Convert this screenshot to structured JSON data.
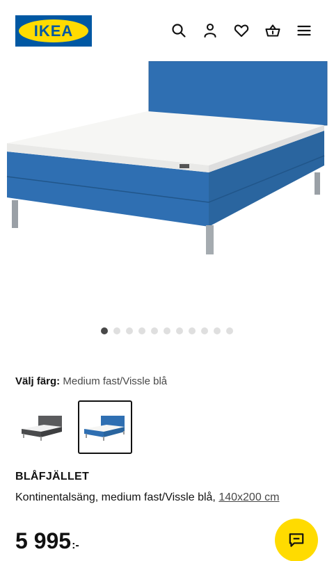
{
  "header": {
    "logo_text": "IKEA",
    "icons": [
      "search-icon",
      "user-icon",
      "heart-icon",
      "basket-icon",
      "menu-icon"
    ]
  },
  "product_image": {
    "color": "#2f6fb2",
    "carousel": {
      "total": 11,
      "active_index": 0
    }
  },
  "color_selector": {
    "label": "Välj färg:",
    "value": "Medium fast/Vissle blå",
    "options": [
      {
        "name": "grey",
        "color": "#5a5b5d",
        "selected": false
      },
      {
        "name": "blue",
        "color": "#2f6fb2",
        "selected": true
      }
    ]
  },
  "product": {
    "name": "BLÅFJÄLLET",
    "description": "Kontinentalsäng, medium fast/Vissle blå,",
    "size_link": "140x200 cm",
    "price": "5 995",
    "price_suffix": ":-"
  },
  "chat": {
    "icon": "chat-icon"
  },
  "colors": {
    "ikea_blue": "#0058a3",
    "ikea_yellow": "#ffdb00"
  }
}
